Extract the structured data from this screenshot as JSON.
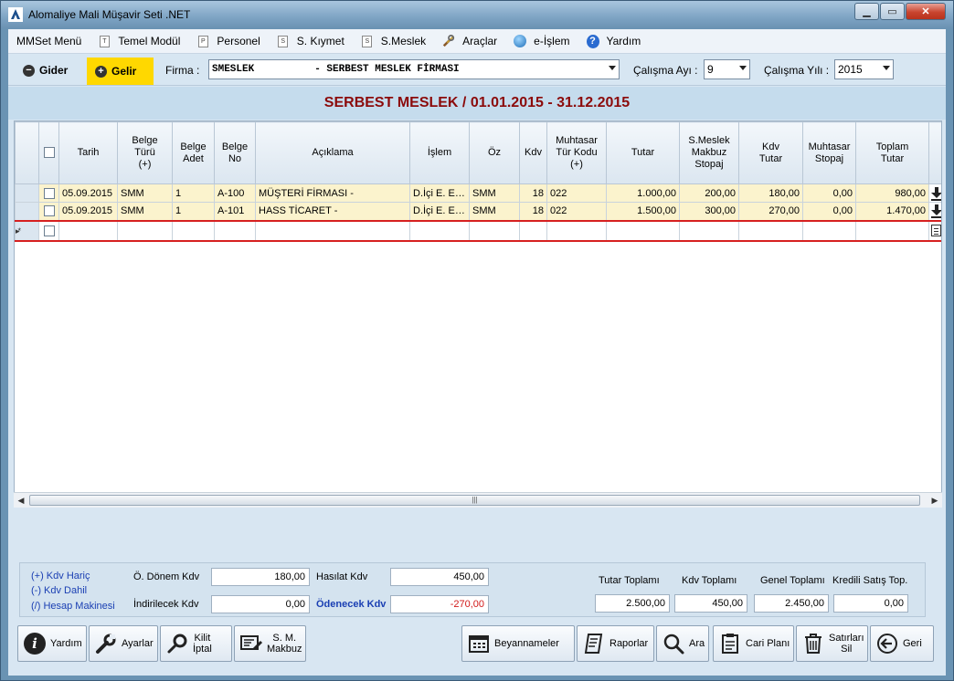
{
  "window": {
    "title": "Alomaliye Mali Müşavir Seti .NET"
  },
  "menu": [
    {
      "label": "MMSet Menü",
      "icon": "none"
    },
    {
      "label": "Temel Modül",
      "icon": "doc-icon",
      "glyph": "T"
    },
    {
      "label": "Personel",
      "icon": "doc-icon",
      "glyph": "P"
    },
    {
      "label": "S. Kıymet",
      "icon": "doc-icon",
      "glyph": "S"
    },
    {
      "label": "S.Meslek",
      "icon": "doc-icon",
      "glyph": "S"
    },
    {
      "label": "Araçlar",
      "icon": "tools-icon"
    },
    {
      "label": "e-İşlem",
      "icon": "globe-icon"
    },
    {
      "label": "Yardım",
      "icon": "help-icon"
    }
  ],
  "filters": {
    "gider_label": "Gider",
    "gelir_label": "Gelir",
    "firma_label": "Firma :",
    "firma_value": "SMESLEK          - SERBEST MESLEK FİRMASI",
    "ay_label": "Çalışma Ayı :",
    "ay_value": "9",
    "yil_label": "Çalışma Yılı :",
    "yil_value": "2015"
  },
  "heading": "SERBEST MESLEK / 01.01.2015 - 31.12.2015",
  "grid": {
    "columns": [
      "Tarih",
      "Belge\nTürü\n(+)",
      "Belge\nAdet",
      "Belge\nNo",
      "Açıklama",
      "İşlem",
      "Öz",
      "Kdv",
      "Muhtasar\nTür Kodu\n(+)",
      "Tutar",
      "S.Meslek\nMakbuz\nStopaj",
      "Kdv\nTutar",
      "Muhtasar\nStopaj",
      "Toplam\nTutar"
    ],
    "rows": [
      {
        "tarih": "05.09.2015",
        "tur": "SMM",
        "adet": "1",
        "no": "A-100",
        "aciklama": "MÜŞTERİ FİRMASI -",
        "islem": "D.İçi E. E....",
        "oz": "SMM",
        "kdv": "18",
        "kod": "022",
        "tutar": "1.000,00",
        "stopaj": "200,00",
        "kdv_tutar": "180,00",
        "muhtasar": "0,00",
        "toplam": "980,00"
      },
      {
        "tarih": "05.09.2015",
        "tur": "SMM",
        "adet": "1",
        "no": "A-101",
        "aciklama": "HASS TİCARET -",
        "islem": "D.İçi E. E....",
        "oz": "SMM",
        "kdv": "18",
        "kod": "022",
        "tutar": "1.500,00",
        "stopaj": "300,00",
        "kdv_tutar": "270,00",
        "muhtasar": "0,00",
        "toplam": "1.470,00"
      }
    ],
    "new_row_marker": "▸*"
  },
  "totals": {
    "kdv_haric": "(+) Kdv Hariç",
    "kdv_dahil": "(-)  Kdv Dahil",
    "hesap_makinesi": "(/) Hesap Makinesi",
    "onceki_donem_label": "Ö. Dönem Kdv",
    "onceki_donem_value": "180,00",
    "indirilecek_label": "İndirilecek Kdv",
    "indirilecek_value": "0,00",
    "hasilat_label": "Hasılat Kdv",
    "hasilat_value": "450,00",
    "odenecek_label": "Ödenecek Kdv",
    "odenecek_value": "-270,00",
    "tutar_toplami_label": "Tutar Toplamı",
    "tutar_toplami_value": "2.500,00",
    "kdv_toplami_label": "Kdv Toplamı",
    "kdv_toplami_value": "450,00",
    "genel_toplami_label": "Genel Toplamı",
    "genel_toplami_value": "2.450,00",
    "kredili_label": "Kredili Satış Top.",
    "kredili_value": "0,00"
  },
  "buttons": {
    "yardim": "Yardım",
    "ayarlar": "Ayarlar",
    "kilit_iptal": "Kilit\nİptal",
    "sm_makbuz": "S. M.\nMakbuz",
    "beyannameler": "Beyannameler",
    "raporlar": "Raporlar",
    "ara": "Ara",
    "cari_plani": "Cari Planı",
    "satirlari_sil": "Satırları\nSil",
    "geri": "Geri"
  }
}
